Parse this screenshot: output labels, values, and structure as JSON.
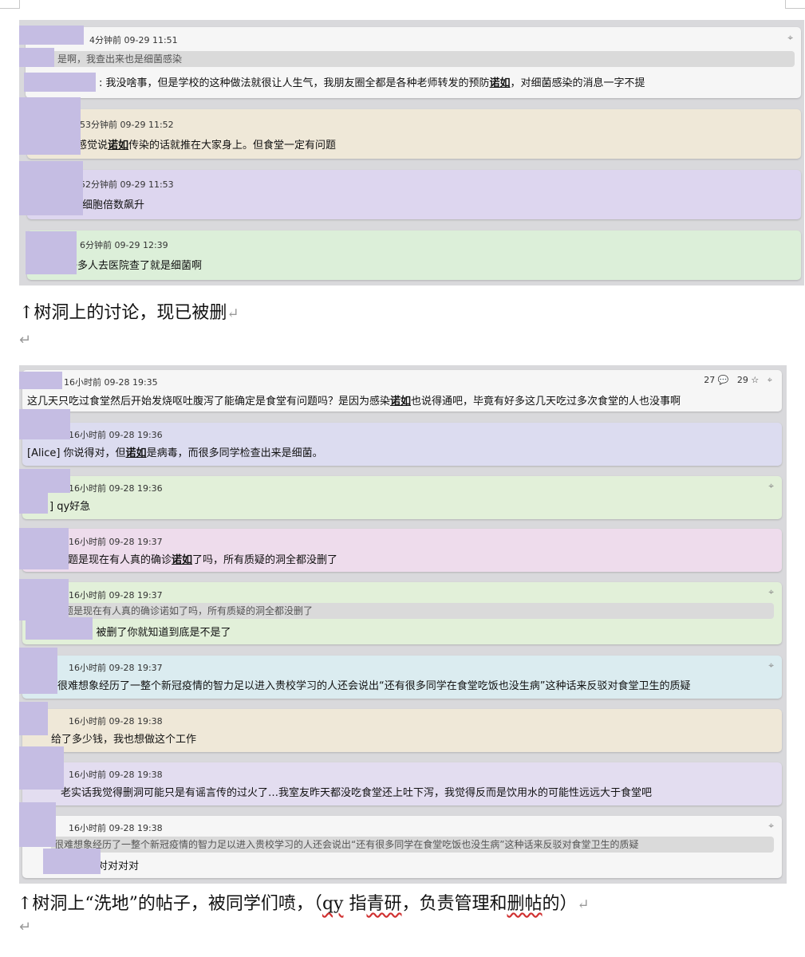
{
  "paragraph_mark": "↵",
  "screenshot1": {
    "posts": [
      {
        "meta": "4分钟前 09-29 11:51",
        "quote": "是啊，我查出来也是细菌感染",
        "text_before": ": 我没啥事，但是学校的这种做法就很让人生气，我朋友圈全都是各种老师转发的预防",
        "bold": "诺如",
        "text_after": "，对细菌感染的消息一字不提",
        "pin_icon": "pin-icon",
        "color": "#f6f6f6"
      },
      {
        "meta": "53分钟前 09-29 11:52",
        "text_before": "感觉说",
        "bold": "诺如",
        "text_after": "传染的话就推在大家身上。但食堂一定有问题",
        "color": "#efe8d8"
      },
      {
        "meta": "52分钟前 09-29 11:53",
        "text": "白细胞倍数飙升",
        "color": "#ddd6ef"
      },
      {
        "meta": "6分钟前 09-29 12:39",
        "text": "好多人去医院查了就是细菌啊",
        "color": "#dcefd9"
      }
    ]
  },
  "caption1": "↑树洞上的讨论，现已被删",
  "screenshot2": {
    "posts": [
      {
        "meta": "16小时前 09-28 19:35",
        "stats": {
          "comments": "27",
          "stars": "29"
        },
        "text_before": "这几天只吃过食堂然后开始发烧呕吐腹泻了能确定是食堂有问题吗？是因为感染",
        "bold": "诺如",
        "text_after": "也说得通吧，毕竟有好多这几天吃过多次食堂的人也没事啊",
        "color": "#f6f6f6"
      },
      {
        "meta": "16小时前 09-28 19:36",
        "text_before": "[Alice] 你说得对，但",
        "bold": "诺如",
        "text_after": "是病毒，而很多同学检查出来是细菌。",
        "color": "#dcdcf0"
      },
      {
        "meta": "16小时前 09-28 19:36",
        "text": "] qy好急",
        "color": "#e2f0d9"
      },
      {
        "meta": "16小时前 09-28 19:37",
        "text_before": "问题是现在有人真的确诊",
        "bold": "诺如",
        "text_after": "了吗，所有质疑的洞全都没删了",
        "color": "#eedcec"
      },
      {
        "meta": "16小时前 09-28 19:37",
        "quote": "问题是现在有人真的确诊诺如了吗，所有质疑的洞全都没删了",
        "text": ": 被删了你就知道到底是不是了",
        "color": "#e2f0d9"
      },
      {
        "meta": "16小时前 09-28 19:37",
        "text": "很难想象经历了一整个新冠疫情的智力足以进入贵校学习的人还会说出“还有很多同学在食堂吃饭也没生病”这种话来反驳对食堂卫生的质疑",
        "color": "#dbecf0"
      },
      {
        "meta": "16小时前 09-28 19:38",
        "text": "给了多少钱，我也想做这个工作",
        "color": "#efe8d8"
      },
      {
        "meta": "16小时前 09-28 19:38",
        "text": "老实话我觉得删洞可能只是有谣言传的过火了…我室友昨天都没吃食堂还上吐下泻，我觉得反而是饮用水的可能性远远大于食堂吧",
        "color": "#e3ddf0"
      },
      {
        "meta": "16小时前 09-28 19:38",
        "quote": "很难想象经历了一整个新冠疫情的智力足以进入贵校学习的人还会说出“还有很多同学在食堂吃饭也没生病”这种话来反驳对食堂卫生的质疑",
        "text": "对对对对",
        "color": "#f6f6f6"
      }
    ]
  },
  "caption2": {
    "prefix": "↑树洞上“洗地”的帖子，被同学们喷，（",
    "qy": "qy",
    "mid1": " 指",
    "qingyan": "青研",
    "mid2": "，负责管理和",
    "shantie": "删帖",
    "suffix": "的）"
  }
}
